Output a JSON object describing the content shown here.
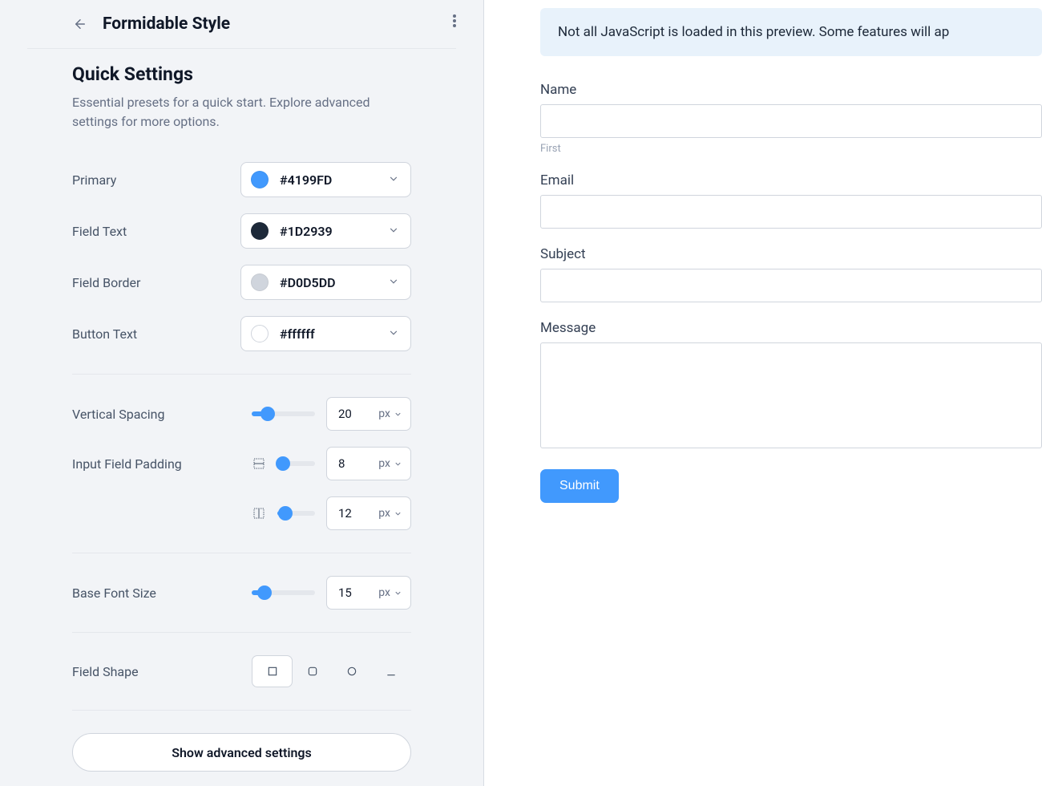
{
  "header": {
    "title": "Formidable Style"
  },
  "quick": {
    "title": "Quick Settings",
    "description": "Essential presets for a quick start. Explore advanced settings for more options."
  },
  "colors": {
    "primary": {
      "label": "Primary",
      "value": "#4199FD",
      "swatch": "#4199FD"
    },
    "field_text": {
      "label": "Field Text",
      "value": "#1D2939",
      "swatch": "#1D2939"
    },
    "field_border": {
      "label": "Field Border",
      "value": "#D0D5DD",
      "swatch": "#D0D5DD"
    },
    "button_text": {
      "label": "Button Text",
      "value": "#ffffff",
      "swatch": "#ffffff"
    }
  },
  "sliders": {
    "vertical_spacing": {
      "label": "Vertical Spacing",
      "value": "20",
      "unit": "px",
      "percent": 25
    },
    "padding_y": {
      "label": "Input Field Padding",
      "value": "8",
      "unit": "px",
      "percent": 15
    },
    "padding_x": {
      "value": "12",
      "unit": "px",
      "percent": 22
    },
    "base_font_size": {
      "label": "Base Font Size",
      "value": "15",
      "unit": "px",
      "percent": 20
    }
  },
  "field_shape": {
    "label": "Field Shape"
  },
  "advanced_button": "Show advanced settings",
  "preview": {
    "notice": "Not all JavaScript is loaded in this preview. Some features will ap",
    "name": {
      "label": "Name",
      "sublabel": "First"
    },
    "email": {
      "label": "Email"
    },
    "subject": {
      "label": "Subject"
    },
    "message": {
      "label": "Message"
    },
    "submit": "Submit"
  }
}
